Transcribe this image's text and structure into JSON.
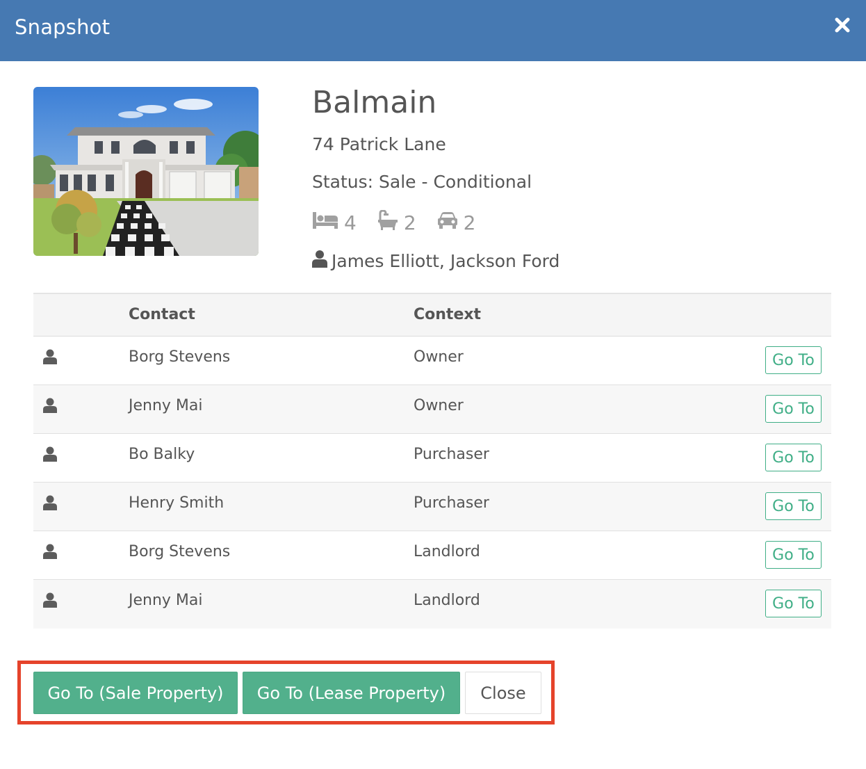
{
  "dialog": {
    "title": "Snapshot",
    "close_icon": "close-icon"
  },
  "property": {
    "suburb": "Balmain",
    "address": "74 Patrick Lane",
    "status": "Status: Sale - Conditional",
    "bedrooms": "4",
    "bathrooms": "2",
    "car_spaces": "2",
    "agents": "James Elliott, Jackson Ford",
    "photo_alt": "property-photo"
  },
  "table": {
    "headers": {
      "icon": "",
      "contact": "Contact",
      "context": "Context"
    },
    "rows": [
      {
        "contact": "Borg Stevens",
        "context": "Owner",
        "action": "Go To"
      },
      {
        "contact": "Jenny Mai",
        "context": "Owner",
        "action": "Go To"
      },
      {
        "contact": "Bo Balky",
        "context": "Purchaser",
        "action": "Go To"
      },
      {
        "contact": "Henry Smith",
        "context": "Purchaser",
        "action": "Go To"
      },
      {
        "contact": "Borg Stevens",
        "context": "Landlord",
        "action": "Go To"
      },
      {
        "contact": "Jenny Mai",
        "context": "Landlord",
        "action": "Go To"
      }
    ]
  },
  "footer": {
    "sale_button": "Go To (Sale Property)",
    "lease_button": "Go To (Lease Property)",
    "close_button": "Close"
  },
  "colors": {
    "header_bg": "#4679b2",
    "accent_green": "#52b08c",
    "highlight_red": "#e5432b"
  }
}
